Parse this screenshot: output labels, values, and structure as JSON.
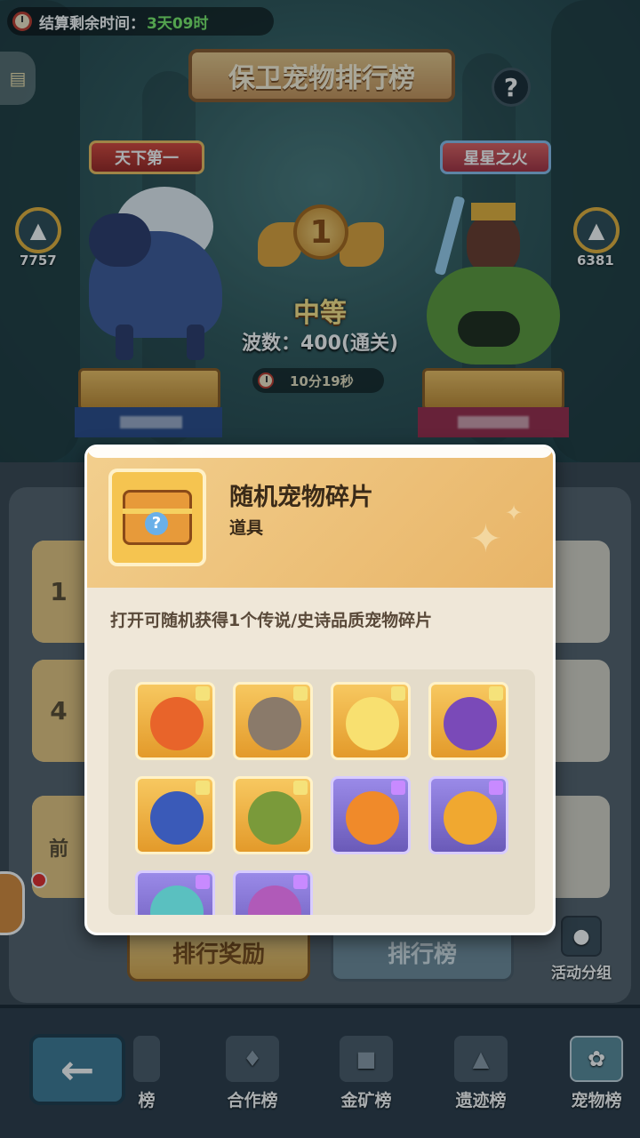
{
  "timer": {
    "label": "结算剩余时间：",
    "value": "3天09时"
  },
  "title": "保卫宠物排行榜",
  "help_label": "?",
  "left_player": {
    "title": "天下第一",
    "likes": "7757"
  },
  "right_player": {
    "title": "星星之火",
    "likes": "6381"
  },
  "rank": {
    "number": "1",
    "grade": "中等",
    "wave": "波数：400(通关)",
    "time": "10分19秒"
  },
  "list": {
    "row1_tab": "1",
    "row2_tab": "4",
    "row3_tab": "前"
  },
  "tabs": {
    "reward": "排行奖励",
    "rank": "排行榜"
  },
  "group_button": "活动分组",
  "bottom_nav": [
    {
      "label": "榜"
    },
    {
      "label": "合作榜"
    },
    {
      "label": "金矿榜"
    },
    {
      "label": "遗迹榜"
    },
    {
      "label": "宠物榜"
    }
  ],
  "popup": {
    "item_name": "随机宠物碎片",
    "item_type": "道具",
    "description": "打开可随机获得1个传说/史诗品质宠物碎片",
    "pets": [
      {
        "rarity": "legend",
        "color": "#e8642a"
      },
      {
        "rarity": "legend",
        "color": "#8a7a6a"
      },
      {
        "rarity": "legend",
        "color": "#f8e070"
      },
      {
        "rarity": "legend",
        "color": "#7a4ab8"
      },
      {
        "rarity": "legend",
        "color": "#3a5ab8"
      },
      {
        "rarity": "legend",
        "color": "#7a9a3a"
      },
      {
        "rarity": "epic",
        "color": "#f08a2a"
      },
      {
        "rarity": "epic",
        "color": "#f0a830"
      },
      {
        "rarity": "epic",
        "color": "#5ac0c0"
      },
      {
        "rarity": "epic",
        "color": "#b05ab8"
      }
    ]
  }
}
